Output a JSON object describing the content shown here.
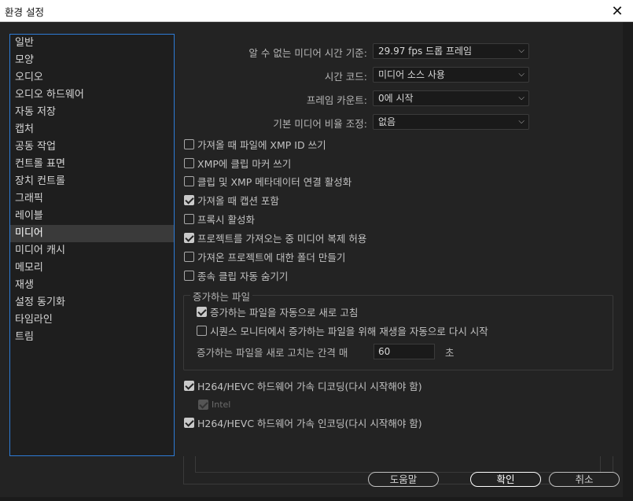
{
  "window": {
    "title": "환경 설정"
  },
  "sidebar": {
    "items": [
      {
        "label": "일반"
      },
      {
        "label": "모양"
      },
      {
        "label": "오디오"
      },
      {
        "label": "오디오 하드웨어"
      },
      {
        "label": "자동 저장"
      },
      {
        "label": "캡처"
      },
      {
        "label": "공동 작업"
      },
      {
        "label": "컨트롤 표면"
      },
      {
        "label": "장치 컨트롤"
      },
      {
        "label": "그래픽"
      },
      {
        "label": "레이블"
      },
      {
        "label": "미디어"
      },
      {
        "label": "미디어 캐시"
      },
      {
        "label": "메모리"
      },
      {
        "label": "재생"
      },
      {
        "label": "설정 동기화"
      },
      {
        "label": "타임라인"
      },
      {
        "label": "트림"
      }
    ],
    "active_label": "미디어"
  },
  "settings": {
    "timebase": {
      "label": "알 수 없는 미디어 시간 기준:",
      "value": "29.97 fps 드롭 프레임"
    },
    "timecode": {
      "label": "시간 코드:",
      "value": "미디어 소스 사용"
    },
    "frame_count": {
      "label": "프레임 카운트:",
      "value": "0에 시작"
    },
    "pixel_aspect": {
      "label": "기본 미디어 비율 조정:",
      "value": "없음"
    }
  },
  "checkboxes": [
    {
      "label": "가져올 때 파일에 XMP ID 쓰기",
      "checked": false
    },
    {
      "label": "XMP에 클립 마커 쓰기",
      "checked": false
    },
    {
      "label": "클립 및 XMP 메타데이터 연결 활성화",
      "checked": false
    },
    {
      "label": "가져올 때 캡션 포함",
      "checked": true
    },
    {
      "label": "프록시 활성화",
      "checked": false
    },
    {
      "label": "프로젝트를 가져오는 중 미디어 복제 허용",
      "checked": true
    },
    {
      "label": "가져온 프로젝트에 대한 폴더 만들기",
      "checked": false
    },
    {
      "label": "종속 클립 자동 숨기기",
      "checked": false
    }
  ],
  "growing_files": {
    "legend": "증가하는 파일",
    "auto_refresh": {
      "label": "증가하는 파일을 자동으로 새로 고침",
      "checked": true
    },
    "auto_restart": {
      "label": "시퀀스 모니터에서 증가하는 파일을 위해 재생을 자동으로 다시 시작",
      "checked": false
    },
    "interval_label": "증가하는 파일을 새로 고치는 간격 매",
    "interval_value": "60",
    "interval_unit": "초"
  },
  "hardware": {
    "decode": {
      "label": "H264/HEVC 하드웨어 가속 디코딩(다시 시작해야 함)",
      "checked": true
    },
    "intel": {
      "label": "Intel",
      "checked": true
    },
    "encode": {
      "label": "H264/HEVC 하드웨어 가속 인코딩(다시 시작해야 함)",
      "checked": true
    }
  },
  "buttons": {
    "help": "도움말",
    "ok": "확인",
    "cancel": "취소"
  }
}
